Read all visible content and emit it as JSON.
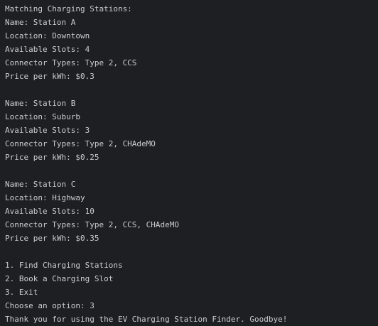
{
  "console": {
    "header": "Matching Charging Stations:",
    "stations": [
      {
        "name": "Name: Station A",
        "location": "Location: Downtown",
        "slots": "Available Slots: 4",
        "connectors": "Connector Types: Type 2, CCS",
        "price": "Price per kWh: $0.3"
      },
      {
        "name": "Name: Station B",
        "location": "Location: Suburb",
        "slots": "Available Slots: 3",
        "connectors": "Connector Types: Type 2, CHAdeMO",
        "price": "Price per kWh: $0.25"
      },
      {
        "name": "Name: Station C",
        "location": "Location: Highway",
        "slots": "Available Slots: 10",
        "connectors": "Connector Types: Type 2, CCS, CHAdeMO",
        "price": "Price per kWh: $0.35"
      }
    ],
    "menu": [
      "1. Find Charging Stations",
      "2. Book a Charging Slot",
      "3. Exit"
    ],
    "prompt": "Choose an option: 3",
    "farewell": "Thank you for using the EV Charging Station Finder. Goodbye!"
  }
}
